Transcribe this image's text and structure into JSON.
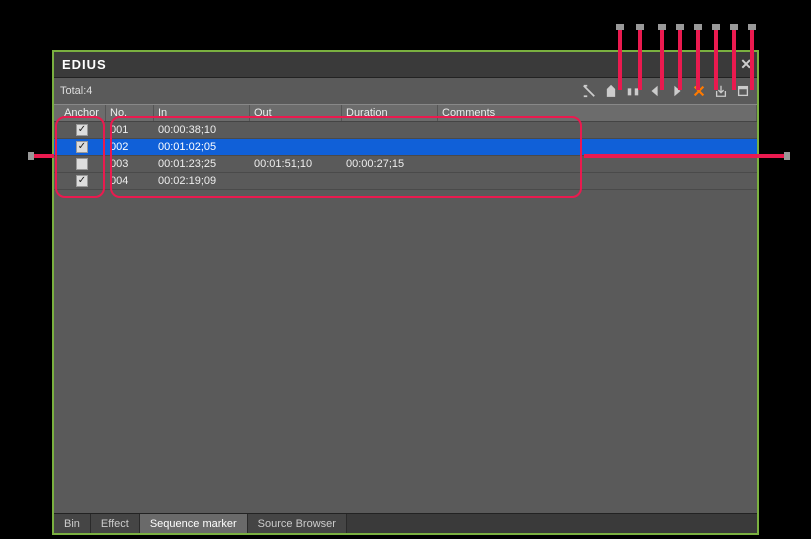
{
  "app": {
    "title": "EDIUS"
  },
  "total": {
    "label": "Total:4"
  },
  "columns": {
    "anchor": "Anchor",
    "no": "No.",
    "in": "In",
    "out": "Out",
    "duration": "Duration",
    "comments": "Comments"
  },
  "rows": [
    {
      "anchor": true,
      "no": "001",
      "in": "00:00:38;10",
      "out": "",
      "duration": "",
      "comments": "",
      "selected": false
    },
    {
      "anchor": true,
      "no": "002",
      "in": "00:01:02;05",
      "out": "",
      "duration": "",
      "comments": "",
      "selected": true
    },
    {
      "anchor": false,
      "no": "003",
      "in": "00:01:23;25",
      "out": "00:01:51;10",
      "duration": "00:00:27;15",
      "comments": "",
      "selected": false
    },
    {
      "anchor": true,
      "no": "004",
      "in": "00:02:19;09",
      "out": "",
      "duration": "",
      "comments": "",
      "selected": false
    }
  ],
  "tabs": [
    {
      "label": "Bin",
      "active": false
    },
    {
      "label": "Effect",
      "active": false
    },
    {
      "label": "Sequence marker",
      "active": true
    },
    {
      "label": "Source Browser",
      "active": false
    }
  ],
  "toolbar": {
    "icons": [
      "toggle-anchor-icon",
      "marker-add-icon",
      "marker-inout-icon",
      "prev-marker-icon",
      "next-marker-icon",
      "delete-marker-icon",
      "import-icon",
      "export-icon"
    ]
  }
}
